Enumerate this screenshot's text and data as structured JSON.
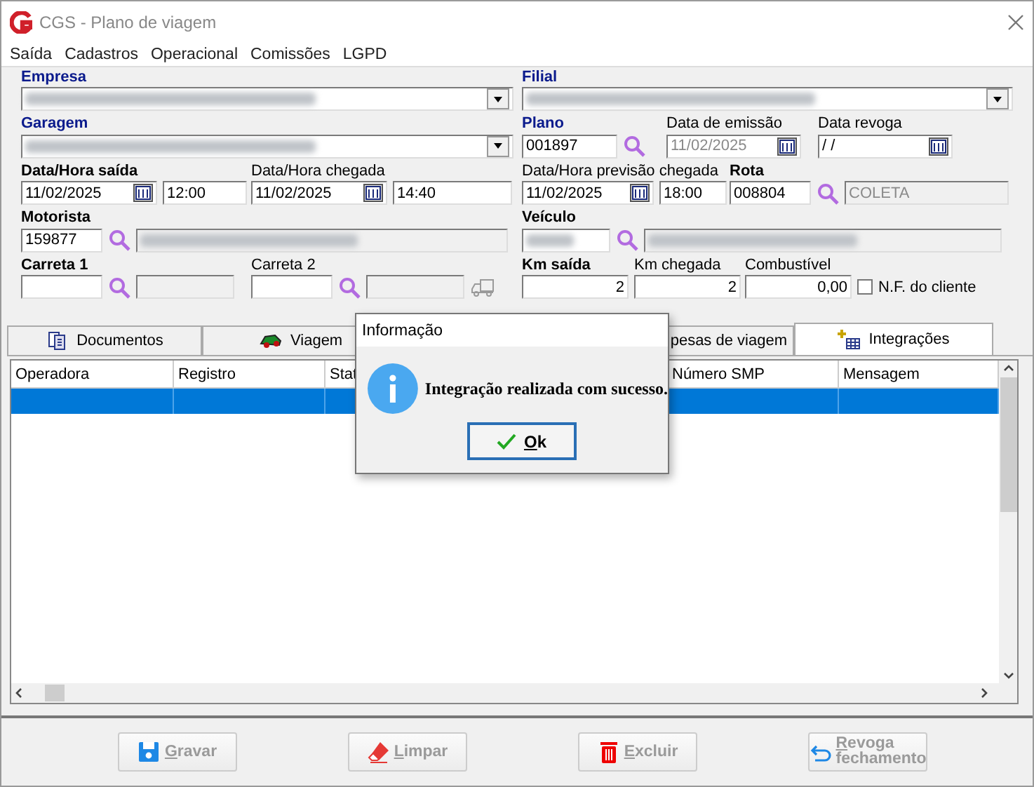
{
  "window": {
    "title": "CGS - Plano de viagem"
  },
  "menu": [
    "Saída",
    "Cadastros",
    "Operacional",
    "Comissões",
    "LGPD"
  ],
  "form": {
    "left": [
      [
        {
          "label": "Empresa",
          "kind": "required",
          "controls": [
            {
              "kind": "combo",
              "obscured": true
            }
          ]
        }
      ],
      [
        {
          "label": "Garagem",
          "kind": "required",
          "controls": [
            {
              "kind": "combo",
              "obscured": true
            }
          ]
        }
      ],
      [
        {
          "label": "Data/Hora saída",
          "kind": "bold",
          "controls": [
            {
              "kind": "date",
              "value": "11/02/2025"
            },
            {
              "kind": "text",
              "value": "12:00"
            }
          ]
        },
        {
          "label": "Data/Hora chegada",
          "kind": "plain",
          "controls": [
            {
              "kind": "date",
              "value": "11/02/2025"
            },
            {
              "kind": "text",
              "value": "14:40"
            }
          ]
        }
      ],
      [
        {
          "label": "Motorista",
          "kind": "bold",
          "controls": [
            {
              "kind": "text",
              "value": "159877"
            },
            {
              "kind": "lookup"
            },
            {
              "kind": "display",
              "obscured": true
            }
          ]
        }
      ],
      [
        {
          "label": "Carreta 1",
          "kind": "bold",
          "controls": [
            {
              "kind": "text"
            },
            {
              "kind": "lookup"
            },
            {
              "kind": "display"
            }
          ]
        },
        {
          "label": "Carreta 2",
          "kind": "plain",
          "controls": [
            {
              "kind": "text"
            },
            {
              "kind": "lookup"
            },
            {
              "kind": "display"
            },
            {
              "kind": "truck"
            }
          ]
        }
      ]
    ],
    "right": [
      [
        {
          "label": "Filial",
          "kind": "required",
          "controls": [
            {
              "kind": "combo",
              "obscured": true
            }
          ]
        }
      ],
      [
        {
          "label": "Plano",
          "kind": "required",
          "controls": [
            {
              "kind": "text",
              "value": "001897"
            },
            {
              "kind": "lookup"
            }
          ]
        },
        {
          "label": "Data de emissão",
          "kind": "plain",
          "controls": [
            {
              "kind": "date",
              "value": "11/02/2025",
              "disabled": true
            }
          ]
        },
        {
          "label": "Data revoga",
          "kind": "plain",
          "controls": [
            {
              "kind": "date",
              "value": "/ /"
            }
          ]
        }
      ],
      [
        {
          "label": "Data/Hora previsão chegada",
          "kind": "plain",
          "controls": [
            {
              "kind": "date",
              "value": "11/02/2025"
            },
            {
              "kind": "text",
              "value": "18:00"
            }
          ]
        },
        {
          "label": "Rota",
          "kind": "bold",
          "controls": [
            {
              "kind": "text",
              "value": "008804"
            },
            {
              "kind": "lookup"
            },
            {
              "kind": "display",
              "value": "COLETA"
            }
          ]
        }
      ],
      [
        {
          "label": "Veículo",
          "kind": "bold",
          "controls": [
            {
              "kind": "text",
              "obscured": true
            },
            {
              "kind": "lookup"
            },
            {
              "kind": "display",
              "obscured": true
            }
          ]
        }
      ],
      [
        {
          "label": "Km saída",
          "kind": "bold",
          "controls": [
            {
              "kind": "number",
              "value": "2"
            }
          ]
        },
        {
          "label": "Km chegada",
          "kind": "plain",
          "controls": [
            {
              "kind": "number",
              "value": "2"
            }
          ]
        },
        {
          "label": "Combustível",
          "kind": "plain",
          "controls": [
            {
              "kind": "number",
              "value": "0,00"
            },
            {
              "kind": "check",
              "label": "N.F. do cliente",
              "checked": false
            }
          ]
        }
      ]
    ]
  },
  "tabs": [
    {
      "label": "Documentos",
      "kind": "documents",
      "selected": false
    },
    {
      "label": "Viagem",
      "kind": "car",
      "selected": false
    },
    {
      "label": "pesas de viagem",
      "kind": "plain",
      "selected": false
    },
    {
      "label": "Integrações",
      "kind": "grid",
      "selected": true
    }
  ],
  "table": {
    "columns": [
      "Operadora",
      "Registro",
      "Stat",
      "Número SMP",
      "Mensagem"
    ],
    "rows": [
      {
        "selected": true
      }
    ]
  },
  "dialog": {
    "title": "Informação",
    "message": "Integração realizada com sucesso.",
    "button": {
      "label": "Ok"
    }
  },
  "buttons": [
    {
      "label": "Gravar",
      "kind": "save",
      "disabled": true
    },
    {
      "label": "Limpar",
      "kind": "eraser",
      "disabled": true
    },
    {
      "label": "Excluir",
      "kind": "trash",
      "disabled": true
    },
    {
      "label": "Revoga fechamento",
      "kind": "undo",
      "disabled": true
    }
  ]
}
